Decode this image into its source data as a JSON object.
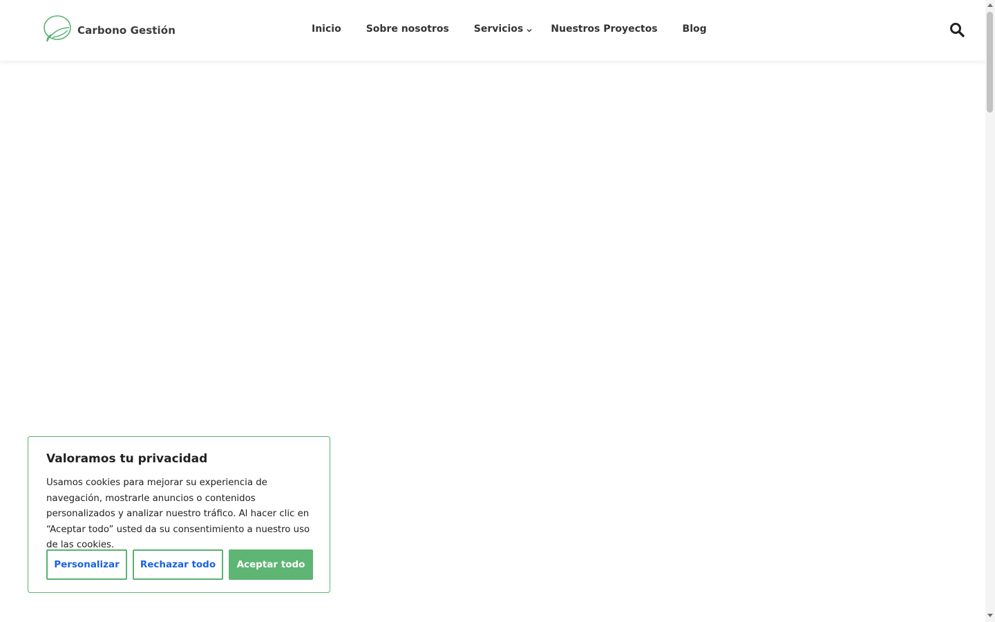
{
  "brand": {
    "name": "Carbono Gestión",
    "accent_color": "#57b26f"
  },
  "nav": {
    "items": [
      {
        "label": "Inicio"
      },
      {
        "label": "Sobre nosotros"
      },
      {
        "label": "Servicios"
      },
      {
        "label": "Nuestros Proyectos"
      },
      {
        "label": "Blog"
      }
    ],
    "servicios_icon": "chevron-down-icon",
    "search_icon": "search-icon"
  },
  "cookie_banner": {
    "title": "Valoramos tu privacidad",
    "text": "Usamos cookies para mejorar su experiencia de navegación, mostrarle anuncios o contenidos personalizados y analizar nuestro tráfico. Al hacer clic en “Aceptar todo” usted da su consentimiento a nuestro uso de las cookies.",
    "customize_label": "Personalizar",
    "reject_label": "Rechazar todo",
    "accept_label": "Aceptar todo",
    "button_text_color": "#1863dc",
    "accept_bg_color": "#5fb574"
  }
}
